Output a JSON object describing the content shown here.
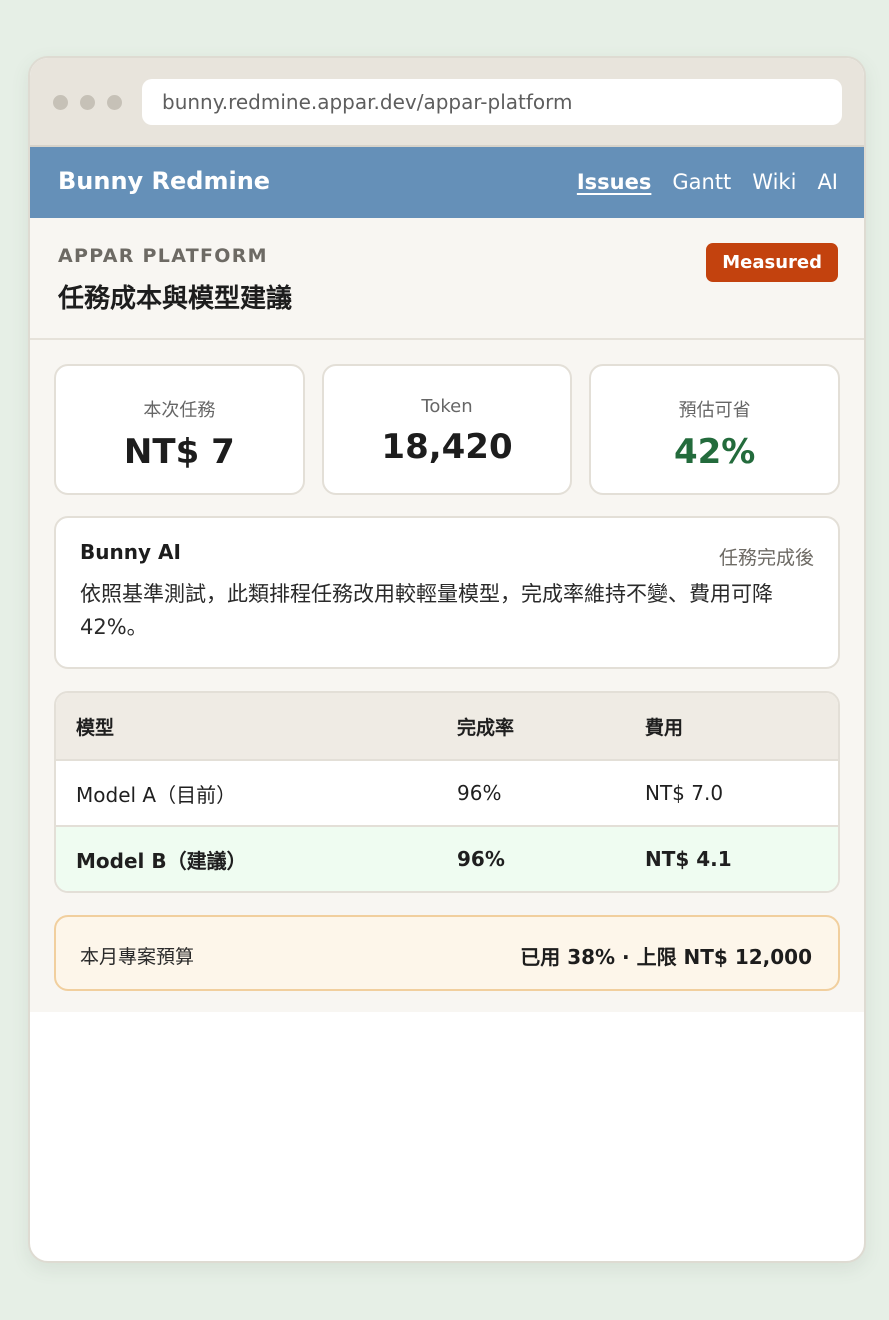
{
  "browser": {
    "url": "bunny.redmine.appar.dev/appar-platform"
  },
  "app": {
    "title": "Bunny Redmine",
    "nav": [
      {
        "label": "Issues",
        "active": true
      },
      {
        "label": "Gantt",
        "active": false
      },
      {
        "label": "Wiki",
        "active": false
      },
      {
        "label": "AI",
        "active": false
      }
    ]
  },
  "project": {
    "name": "APPAR PLATFORM",
    "title": "任務成本與模型建議",
    "badge": "Measured"
  },
  "stats": [
    {
      "label": "本次任務",
      "value": "NT$ 7"
    },
    {
      "label": "Token",
      "value": "18,420"
    },
    {
      "label": "預估可省",
      "value": "42%"
    }
  ],
  "ai": {
    "name": "Bunny AI",
    "status": "任務完成後",
    "message": "依照基準測試，此類排程任務改用較輕量模型，完成率維持不變、費用可降 42%。"
  },
  "table": {
    "headers": [
      "模型",
      "完成率",
      "費用"
    ],
    "rows": [
      [
        "Model A（目前）",
        "96%",
        "NT$ 7.0"
      ],
      [
        "Model B（建議）",
        "96%",
        "NT$ 4.1"
      ]
    ]
  },
  "budget": {
    "label": "本月專案預算",
    "value": "已用 38% · 上限 NT$ 12,000"
  },
  "colors": {
    "header": "#6590b8",
    "badge": "#c3420e",
    "savings": "#236b3c",
    "highlight_row": "#effcf1",
    "budget_bg": "#fdf6ea"
  }
}
